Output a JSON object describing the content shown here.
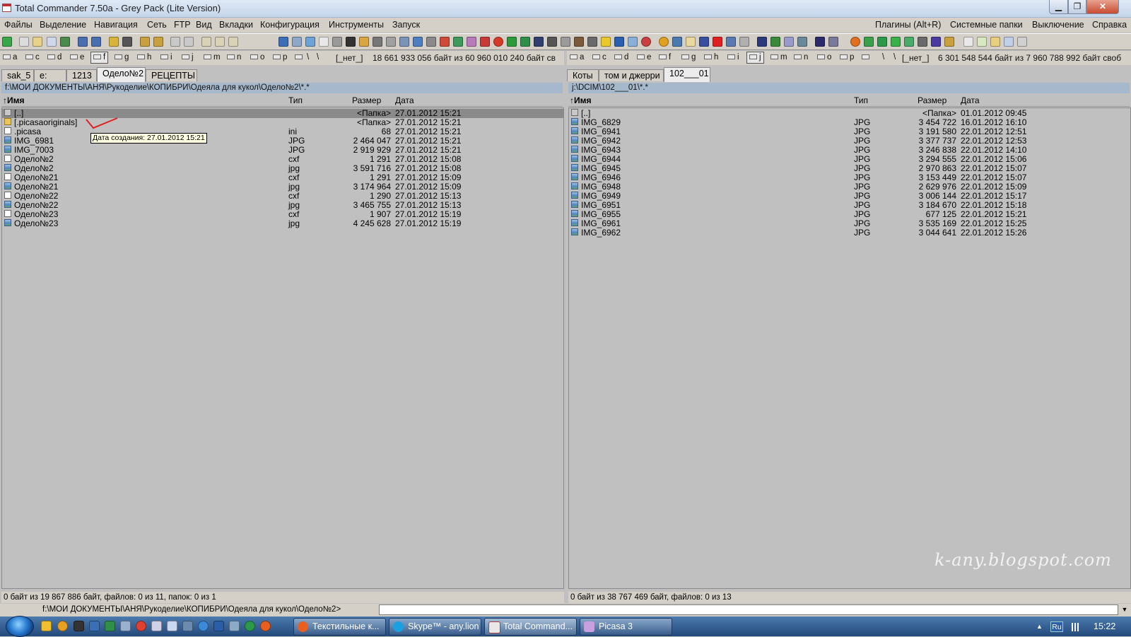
{
  "window": {
    "title": "Total Commander 7.50a - Grey Pack (Lite Version)"
  },
  "menu": {
    "left": [
      "Файлы",
      "Выделение",
      "Навигация",
      "Сеть",
      "FTP",
      "Вид",
      "Вкладки",
      "Конфигурация",
      "Инструменты",
      "Запуск"
    ],
    "right": [
      "Плагины (Alt+R)",
      "Системные папки",
      "Выключение",
      "Справка"
    ]
  },
  "left_panel": {
    "drive_letters": [
      "a",
      "c",
      "d",
      "e",
      "f",
      "g",
      "h",
      "i",
      "j",
      "m",
      "n",
      "o",
      "p"
    ],
    "selected_drive": "f",
    "drive_none": "[_нет_]",
    "free_space": "18 661 933 056 байт из 60 960 010 240 байт св",
    "tabs": [
      "sak_5",
      "e:",
      "1213",
      "Одело№2",
      "РЕЦЕПТЫ"
    ],
    "active_tab": "Одело№2",
    "path": "f:\\МОИ ДОКУМЕНТЫ\\АНЯ\\Рукоделие\\КОПИБРИ\\Одеяла для кукол\\Одело№2\\*.*",
    "columns": {
      "name": "↑Имя",
      "type": "Тип",
      "size": "Размер",
      "date": "Дата"
    },
    "files": [
      {
        "icon": "up",
        "name": "[..]",
        "type": "",
        "size": "<Папка>",
        "date": "27.01.2012 15:21"
      },
      {
        "icon": "folder",
        "name": "[.picasaoriginals]",
        "type": "",
        "size": "<Папка>",
        "date": "27.01.2012 15:21"
      },
      {
        "icon": "doc",
        "name": ".picasa",
        "type": "ini",
        "size": "68",
        "date": "27.01.2012 15:21"
      },
      {
        "icon": "img",
        "name": "IMG_6981",
        "type": "JPG",
        "size": "2 464 047",
        "date": "27.01.2012 15:21"
      },
      {
        "icon": "img",
        "name": "IMG_7003",
        "type": "JPG",
        "size": "2 919 929",
        "date": "27.01.2012 15:21"
      },
      {
        "icon": "doc",
        "name": "Одело№2",
        "type": "cxf",
        "size": "1 291",
        "date": "27.01.2012 15:08"
      },
      {
        "icon": "img",
        "name": "Одело№2",
        "type": "jpg",
        "size": "3 591 716",
        "date": "27.01.2012 15:08"
      },
      {
        "icon": "doc",
        "name": "Одело№21",
        "type": "cxf",
        "size": "1 291",
        "date": "27.01.2012 15:09"
      },
      {
        "icon": "img",
        "name": "Одело№21",
        "type": "jpg",
        "size": "3 174 964",
        "date": "27.01.2012 15:09"
      },
      {
        "icon": "doc",
        "name": "Одело№22",
        "type": "cxf",
        "size": "1 290",
        "date": "27.01.2012 15:13"
      },
      {
        "icon": "img",
        "name": "Одело№22",
        "type": "jpg",
        "size": "3 465 755",
        "date": "27.01.2012 15:13"
      },
      {
        "icon": "doc",
        "name": "Одело№23",
        "type": "cxf",
        "size": "1 907",
        "date": "27.01.2012 15:19"
      },
      {
        "icon": "img",
        "name": "Одело№23",
        "type": "jpg",
        "size": "4 245 628",
        "date": "27.01.2012 15:19"
      }
    ],
    "tooltip": "Дата создания: 27.01.2012 15:21",
    "status": "0 байт из 19 867 886 байт, файлов: 0 из 11, папок: 0 из 1"
  },
  "right_panel": {
    "drive_letters": [
      "a",
      "c",
      "d",
      "e",
      "f",
      "g",
      "h",
      "i",
      "j",
      "m",
      "n",
      "o",
      "p"
    ],
    "selected_drive": "j",
    "drive_none": "[_нет_]",
    "free_space": "6 301 548 544 байт из 7 960 788 992 байт своб",
    "tabs": [
      "Коты",
      "том и джерри",
      "102___01"
    ],
    "active_tab": "102___01",
    "path": "j:\\DCIM\\102___01\\*.*",
    "columns": {
      "name": "↑Имя",
      "type": "Тип",
      "size": "Размер",
      "date": "Дата"
    },
    "files": [
      {
        "icon": "up",
        "name": "[..]",
        "type": "",
        "size": "<Папка>",
        "date": "01.01.2012 09:45"
      },
      {
        "icon": "img",
        "name": "IMG_6829",
        "type": "JPG",
        "size": "3 454 722",
        "date": "16.01.2012 16:10"
      },
      {
        "icon": "img",
        "name": "IMG_6941",
        "type": "JPG",
        "size": "3 191 580",
        "date": "22.01.2012 12:51"
      },
      {
        "icon": "img",
        "name": "IMG_6942",
        "type": "JPG",
        "size": "3 377 737",
        "date": "22.01.2012 12:53"
      },
      {
        "icon": "img",
        "name": "IMG_6943",
        "type": "JPG",
        "size": "3 246 838",
        "date": "22.01.2012 14:10"
      },
      {
        "icon": "img",
        "name": "IMG_6944",
        "type": "JPG",
        "size": "3 294 555",
        "date": "22.01.2012 15:06"
      },
      {
        "icon": "img",
        "name": "IMG_6945",
        "type": "JPG",
        "size": "2 970 863",
        "date": "22.01.2012 15:07"
      },
      {
        "icon": "img",
        "name": "IMG_6946",
        "type": "JPG",
        "size": "3 153 449",
        "date": "22.01.2012 15:07"
      },
      {
        "icon": "img",
        "name": "IMG_6948",
        "type": "JPG",
        "size": "2 629 976",
        "date": "22.01.2012 15:09"
      },
      {
        "icon": "img",
        "name": "IMG_6949",
        "type": "JPG",
        "size": "3 006 144",
        "date": "22.01.2012 15:17"
      },
      {
        "icon": "img",
        "name": "IMG_6951",
        "type": "JPG",
        "size": "3 184 670",
        "date": "22.01.2012 15:18"
      },
      {
        "icon": "img",
        "name": "IMG_6955",
        "type": "JPG",
        "size": "677 125",
        "date": "22.01.2012 15:21"
      },
      {
        "icon": "img",
        "name": "IMG_6961",
        "type": "JPG",
        "size": "3 535 169",
        "date": "22.01.2012 15:25"
      },
      {
        "icon": "img",
        "name": "IMG_6962",
        "type": "JPG",
        "size": "3 044 641",
        "date": "22.01.2012 15:26"
      }
    ],
    "status": "0 байт из 38 767 469 байт, файлов: 0 из 13"
  },
  "command_line": {
    "prompt": "f:\\МОИ ДОКУМЕНТЫ\\АНЯ\\Рукоделие\\КОПИБРИ\\Одеяла для кукол\\Одело№2>",
    "value": ""
  },
  "taskbar": {
    "tasks": [
      "Текстильные к...",
      "Skype™ - any.lion",
      "Total Command...",
      "Picasa 3"
    ],
    "language": "Ru",
    "clock": "15:22"
  },
  "watermark": "k-any.blogspot.com",
  "colors": {
    "panel_bg": "#c0c0c0",
    "path_bar": "#a6b8cc",
    "cursor_row": "#8a8a8a",
    "tooltip_bg": "#ffffe1",
    "taskbar": "#2f5d92"
  },
  "icons": {
    "toolbar": [
      "refresh-icon",
      "brief-view-icon",
      "full-view-icon",
      "tree-icon",
      "thumbnails-icon",
      "back-icon",
      "forward-icon",
      "unpack-icon",
      "search-icon",
      "pack-icon",
      "unpack-files-icon",
      "cut-icon",
      "compare-icon",
      "sync-icon",
      "multi-rename-icon",
      "edit-icon",
      "ftp-connect-icon",
      "ftp-new-icon",
      "settings-icon",
      "help-icon",
      "exit-icon"
    ]
  }
}
